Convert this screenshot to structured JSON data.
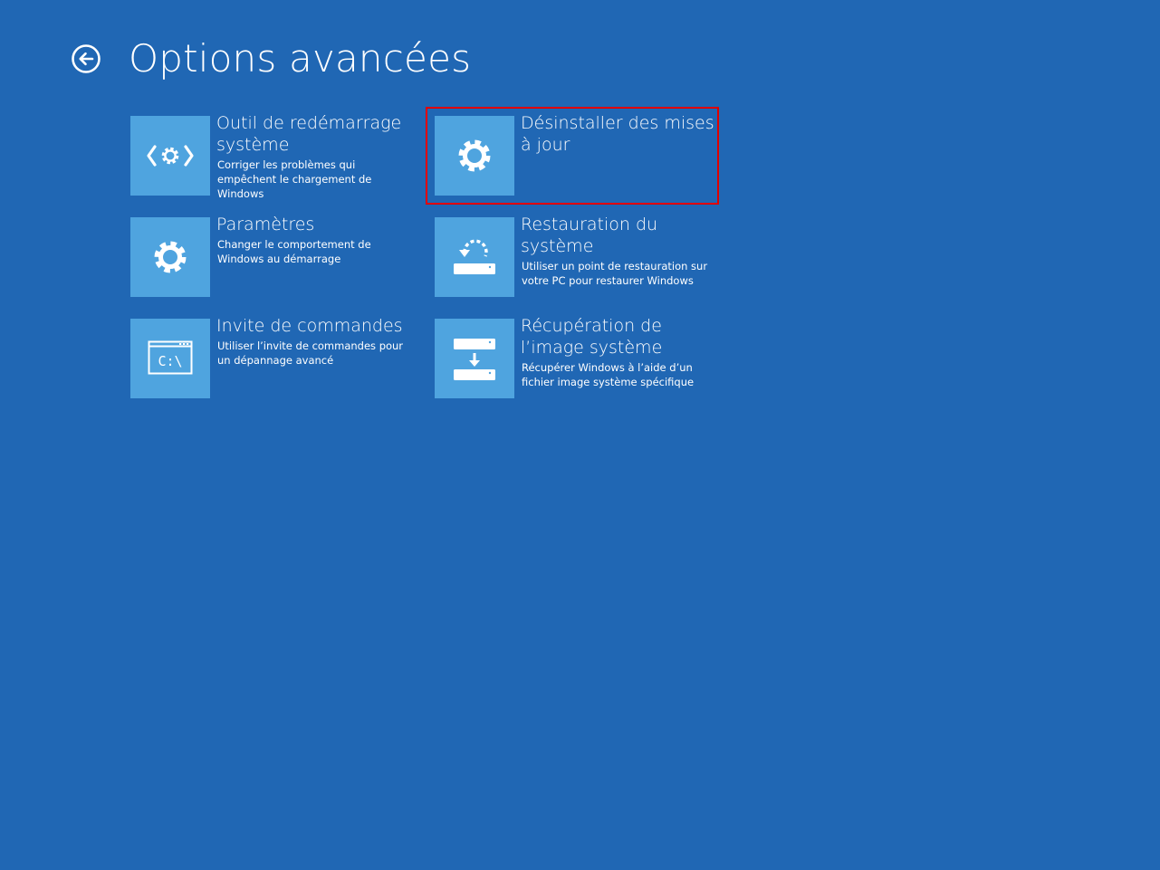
{
  "header": {
    "title": "Options avancées",
    "back_icon": "back-arrow-circle-icon"
  },
  "tiles": [
    {
      "title": "Outil de redémarrage système",
      "description": "Corriger les problèmes qui empêchent le chargement de Windows",
      "icon": "startup-repair-icon"
    },
    {
      "title": "Désinstaller des mises à jour",
      "description": "",
      "icon": "gear-icon"
    },
    {
      "title": "Paramètres",
      "description": "Changer le comportement de Windows au démarrage",
      "icon": "gear-icon"
    },
    {
      "title": "Restauration du système",
      "description": "Utiliser un point de restauration sur votre PC pour restaurer Windows",
      "icon": "system-restore-icon"
    },
    {
      "title": "Invite de commandes",
      "description": "Utiliser l’invite de commandes pour un dépannage avancé",
      "icon": "command-prompt-icon",
      "icon_text": "C:\\"
    },
    {
      "title": "Récupération de l’image système",
      "description": "Récupérer Windows à l’aide d’un fichier image système spécifique",
      "icon": "system-image-recovery-icon"
    }
  ],
  "colors": {
    "background": "#2067b4",
    "tile_icon_bg": "#4fa4df",
    "highlight": "#e00000"
  }
}
